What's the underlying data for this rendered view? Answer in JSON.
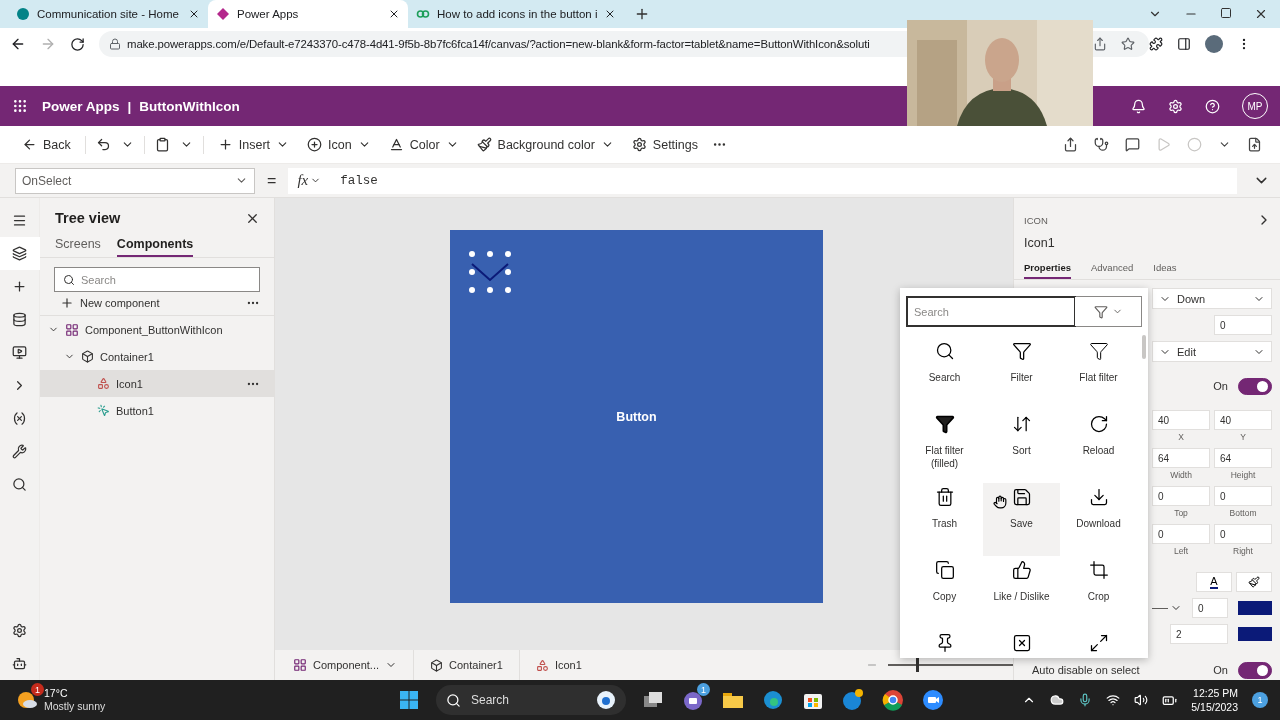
{
  "browser": {
    "tabs": [
      {
        "title": "Communication site - Home",
        "selected": false,
        "kind": "site"
      },
      {
        "title": "Power Apps",
        "selected": true,
        "kind": "apps"
      },
      {
        "title": "How to add icons in the button i",
        "selected": false,
        "kind": "video"
      }
    ],
    "url": "make.powerapps.com/e/Default-e7243370-c478-4d41-9f5b-8b7fc6fca14f/canvas/?action=new-blank&form-factor=tablet&name=ButtonWithIcon&soluti"
  },
  "app_header": {
    "product": "Power Apps",
    "separator": "|",
    "app_name": "ButtonWithIcon",
    "avatar": "MP"
  },
  "command_bar": {
    "back": "Back",
    "items": [
      {
        "label": "Insert",
        "kind": "insert"
      },
      {
        "label": "Icon",
        "kind": "icon"
      },
      {
        "label": "Color",
        "kind": "color"
      },
      {
        "label": "Background color",
        "kind": "background"
      }
    ],
    "settings": "Settings"
  },
  "formula_bar": {
    "property": "OnSelect",
    "equals": "=",
    "fx": "fx",
    "formula": "false"
  },
  "tree_view": {
    "title": "Tree view",
    "tabs": [
      {
        "label": "Screens",
        "selected": false
      },
      {
        "label": "Components",
        "selected": true
      }
    ],
    "search": {
      "placeholder": "Search"
    },
    "new_component": "New component",
    "nodes": [
      {
        "label": "Component_ButtonWithIcon",
        "kind": "component",
        "expanded": true,
        "selected": false,
        "children": [
          {
            "label": "Container1",
            "kind": "container",
            "expanded": true,
            "selected": false,
            "children": [
              {
                "label": "Icon1",
                "kind": "icon",
                "selected": true
              },
              {
                "label": "Button1",
                "kind": "button",
                "selected": false
              }
            ]
          }
        ]
      }
    ]
  },
  "canvas": {
    "button_label": "Button",
    "breadcrumbs": [
      {
        "label": "Component...",
        "kind": "component"
      },
      {
        "label": "Container1",
        "kind": "container"
      },
      {
        "label": "Icon1",
        "kind": "icon"
      }
    ],
    "zoom": {
      "level": 0.22
    }
  },
  "properties": {
    "type": "ICON",
    "name": "Icon1",
    "tabs": [
      {
        "label": "Properties",
        "selected": true
      },
      {
        "label": "Advanced",
        "selected": false
      },
      {
        "label": "Ideas",
        "selected": false
      }
    ],
    "rows": [
      {
        "kind": "dropdown",
        "value": "Down"
      },
      {
        "kind": "field",
        "value": "0"
      },
      {
        "kind": "dropdown",
        "value": "Edit"
      },
      {
        "kind": "toggle",
        "text": "On",
        "on": true
      },
      {
        "kind": "pair",
        "fields": [
          {
            "value": "40",
            "caption": "X"
          },
          {
            "value": "40",
            "caption": "Y"
          }
        ]
      },
      {
        "kind": "pair",
        "fields": [
          {
            "value": "64",
            "caption": "Width"
          },
          {
            "value": "64",
            "caption": "Height"
          }
        ]
      },
      {
        "kind": "pair",
        "fields": [
          {
            "value": "0",
            "caption": "Top"
          },
          {
            "value": "0",
            "caption": "Bottom"
          }
        ]
      },
      {
        "kind": "pair",
        "fields": [
          {
            "value": "0",
            "caption": "Left"
          },
          {
            "value": "0",
            "caption": "Right"
          }
        ]
      },
      {
        "kind": "colors",
        "letter": "A",
        "color": "#0b1a78"
      },
      {
        "kind": "border",
        "value": "0",
        "color": "#0b1a78"
      },
      {
        "kind": "number_color",
        "value": "2",
        "color": "#0b1a78"
      },
      {
        "kind": "labeled_toggle",
        "label": "Auto disable on select",
        "text": "On",
        "on": true
      }
    ]
  },
  "icon_picker": {
    "search": {
      "placeholder": "Search"
    },
    "items": [
      {
        "label": "Search",
        "selected": false
      },
      {
        "label": "Filter",
        "selected": false
      },
      {
        "label": "Flat filter",
        "selected": false
      },
      {
        "label": "Flat filter (filled)",
        "selected": false
      },
      {
        "label": "Sort",
        "selected": false
      },
      {
        "label": "Reload",
        "selected": false
      },
      {
        "label": "Trash",
        "selected": false
      },
      {
        "label": "Save",
        "selected": true
      },
      {
        "label": "Download",
        "selected": false
      },
      {
        "label": "Copy",
        "selected": false
      },
      {
        "label": "Like / Dislike",
        "selected": false
      },
      {
        "label": "Crop",
        "selected": false
      },
      {
        "selected": false
      },
      {
        "selected": false
      },
      {
        "selected": false
      }
    ]
  },
  "taskbar": {
    "weather": {
      "temp": "17°C",
      "condition": "Mostly sunny",
      "badge": "1"
    },
    "search": {
      "placeholder": "Search"
    },
    "chat_badge": "1",
    "time": "12:25 PM",
    "date": "5/15/2023",
    "notifications": "1"
  }
}
